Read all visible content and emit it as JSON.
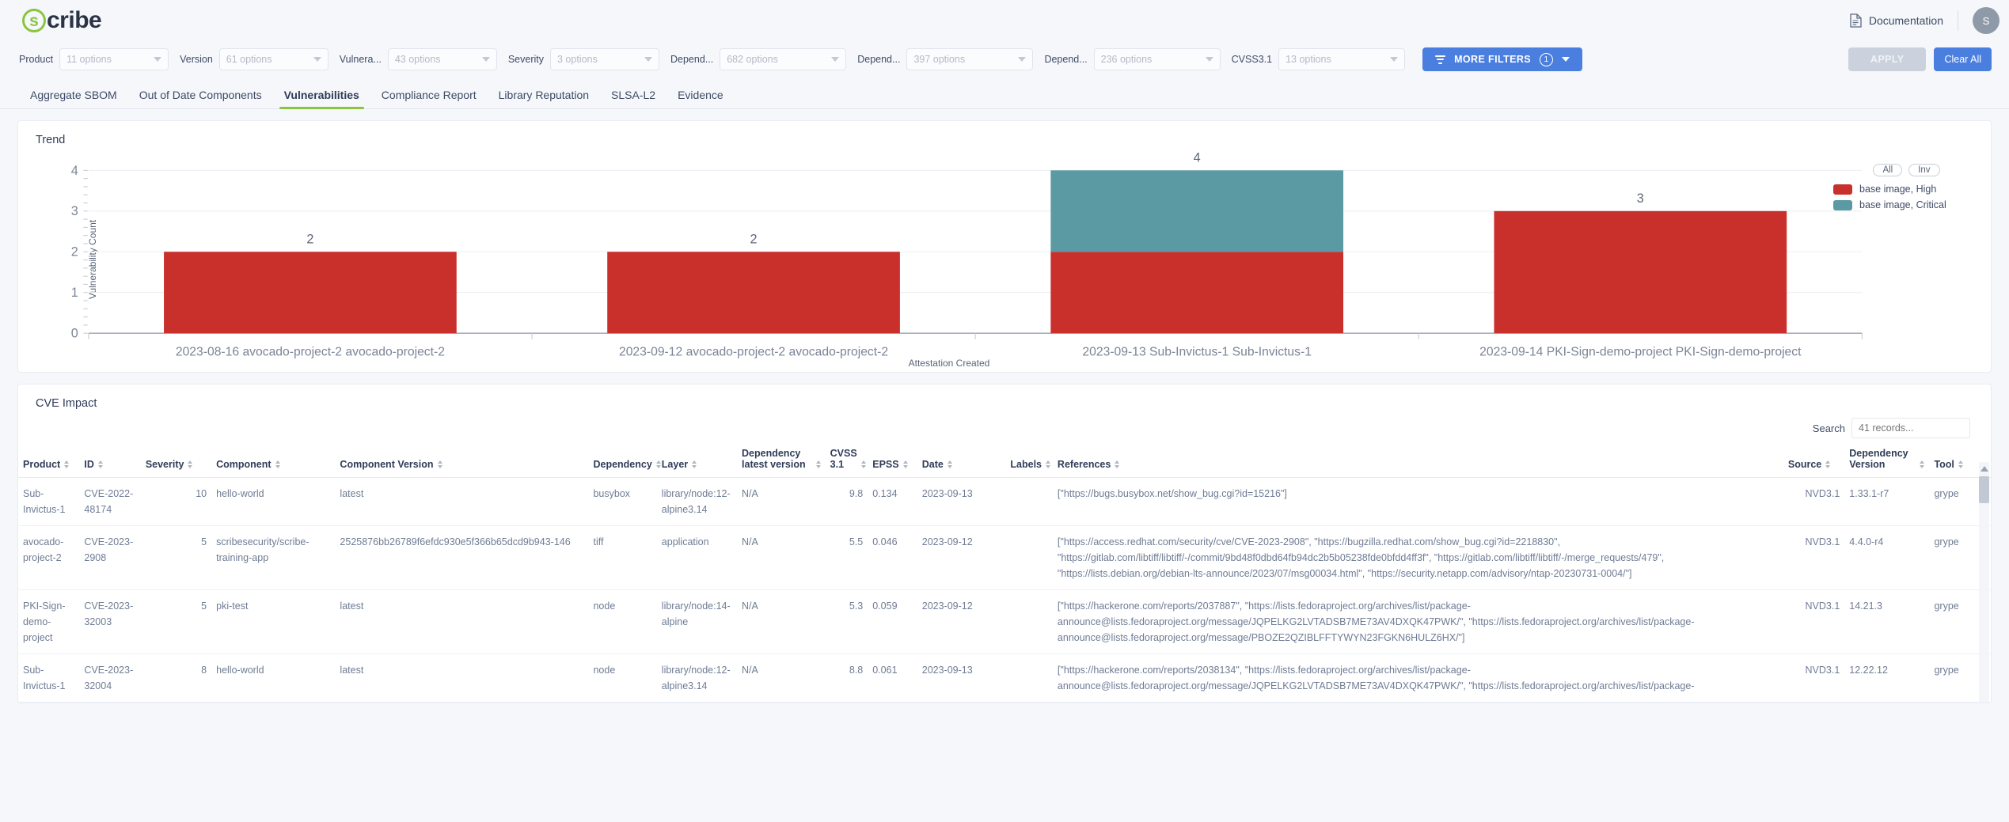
{
  "header": {
    "brand": "scribe",
    "brand_initial": "s",
    "documentation_label": "Documentation",
    "doc_icon": "document-icon",
    "avatar_initial": "S"
  },
  "filters": [
    {
      "label": "Product",
      "value": "11 options",
      "name": "product"
    },
    {
      "label": "Version",
      "value": "61 options",
      "name": "version"
    },
    {
      "label": "Vulnera...",
      "value": "43 options",
      "name": "vulnerability"
    },
    {
      "label": "Severity",
      "value": "3 options",
      "name": "severity"
    },
    {
      "label": "Depend...",
      "value": "682 options",
      "name": "dependency-1"
    },
    {
      "label": "Depend...",
      "value": "397 options",
      "name": "dependency-2"
    },
    {
      "label": "Depend...",
      "value": "236 options",
      "name": "dependency-3"
    },
    {
      "label": "CVSS3.1",
      "value": "13 options",
      "name": "cvss31"
    }
  ],
  "toolbar": {
    "more_filters_label": "MORE FILTERS",
    "more_filters_count": "1",
    "apply_label": "APPLY",
    "clear_all_label": "Clear All"
  },
  "tabs": [
    {
      "label": "Aggregate SBOM",
      "active": false
    },
    {
      "label": "Out of Date Components",
      "active": false
    },
    {
      "label": "Vulnerabilities",
      "active": true
    },
    {
      "label": "Compliance Report",
      "active": false
    },
    {
      "label": "Library Reputation",
      "active": false
    },
    {
      "label": "SLSA-L2",
      "active": false
    },
    {
      "label": "Evidence",
      "active": false
    }
  ],
  "trend": {
    "title": "Trend",
    "toggles": [
      "All",
      "Inv"
    ]
  },
  "chart_data": {
    "type": "bar",
    "title": "Trend",
    "xlabel": "Attestation Created",
    "ylabel": "Vulnerability Count",
    "ylim": [
      0,
      4
    ],
    "yticks": [
      "0",
      "1",
      "2",
      "3",
      "4"
    ],
    "grid": true,
    "legend_position": "right",
    "stacked": true,
    "categories": [
      "2023-08-16 avocado-project-2 avocado-project-2",
      "2023-09-12 avocado-project-2 avocado-project-2",
      "2023-09-13 Sub-Invictus-1 Sub-Invictus-1",
      "2023-09-14 PKI-Sign-demo-project PKI-Sign-demo-project"
    ],
    "totals": [
      "2",
      "2",
      "4",
      "3"
    ],
    "series": [
      {
        "name": "base image, High",
        "color": "#c9302c",
        "values": [
          2,
          2,
          2,
          3
        ]
      },
      {
        "name": "base image, Critical",
        "color": "#5b9aa3",
        "values": [
          0,
          0,
          2,
          0
        ]
      }
    ]
  },
  "cve_impact": {
    "title": "CVE Impact",
    "search_label": "Search",
    "search_placeholder": "41 records...",
    "search_value": "",
    "columns": [
      {
        "label": "Product",
        "sortable": true
      },
      {
        "label": "ID",
        "sortable": true
      },
      {
        "label": "Severity",
        "sortable": true
      },
      {
        "label": "Component",
        "sortable": true
      },
      {
        "label": "Component Version",
        "sortable": true
      },
      {
        "label": "Dependency",
        "sortable": true
      },
      {
        "label": "Layer",
        "sortable": true
      },
      {
        "label": "Dependency latest version",
        "sortable": true
      },
      {
        "label": "CVSS 3.1",
        "sortable": true
      },
      {
        "label": "EPSS",
        "sortable": true
      },
      {
        "label": "Date",
        "sortable": true
      },
      {
        "label": "Labels",
        "sortable": true
      },
      {
        "label": "References",
        "sortable": true
      },
      {
        "label": "Source",
        "sortable": true
      },
      {
        "label": "Dependency Version",
        "sortable": true
      },
      {
        "label": "Tool",
        "sortable": true
      }
    ],
    "rows": [
      {
        "product": "Sub-Invictus-1",
        "id": "CVE-2022-48174",
        "severity": "10",
        "component": "hello-world",
        "component_version": "latest",
        "dependency": "busybox",
        "layer": "library/node:12-alpine3.14",
        "dependency_latest_version": "N/A",
        "cvss31": "9.8",
        "epss": "0.134",
        "date": "2023-09-13",
        "labels": "",
        "references": "[\"https://bugs.busybox.net/show_bug.cgi?id=15216\"]",
        "source": "NVD3.1",
        "dependency_version": "1.33.1-r7",
        "tool": "grype"
      },
      {
        "product": "avocado-project-2",
        "id": "CVE-2023-2908",
        "severity": "5",
        "component": "scribesecurity/scribe-training-app",
        "component_version": "2525876bb26789f6efdc930e5f366b65dcd9b943-146",
        "dependency": "tiff",
        "layer": "application",
        "dependency_latest_version": "N/A",
        "cvss31": "5.5",
        "epss": "0.046",
        "date": "2023-09-12",
        "labels": "",
        "references": "[\"https://access.redhat.com/security/cve/CVE-2023-2908\", \"https://bugzilla.redhat.com/show_bug.cgi?id=2218830\", \"https://gitlab.com/libtiff/libtiff/-/commit/9bd48f0dbd64fb94dc2b5b05238fde0bfdd4ff3f\", \"https://gitlab.com/libtiff/libtiff/-/merge_requests/479\", \"https://lists.debian.org/debian-lts-announce/2023/07/msg00034.html\", \"https://security.netapp.com/advisory/ntap-20230731-0004/\"]",
        "source": "NVD3.1",
        "dependency_version": "4.4.0-r4",
        "tool": "grype"
      },
      {
        "product": "PKI-Sign-demo-project",
        "id": "CVE-2023-32003",
        "severity": "5",
        "component": "pki-test",
        "component_version": "latest",
        "dependency": "node",
        "layer": "library/node:14-alpine",
        "dependency_latest_version": "N/A",
        "cvss31": "5.3",
        "epss": "0.059",
        "date": "2023-09-12",
        "labels": "",
        "references": "[\"https://hackerone.com/reports/2037887\", \"https://lists.fedoraproject.org/archives/list/package-announce@lists.fedoraproject.org/message/JQPELKG2LVTADSB7ME73AV4DXQK47PWK/\", \"https://lists.fedoraproject.org/archives/list/package-announce@lists.fedoraproject.org/message/PBOZE2QZIBLFFTYWYN23FGKN6HULZ6HX/\"]",
        "source": "NVD3.1",
        "dependency_version": "14.21.3",
        "tool": "grype"
      },
      {
        "product": "Sub-Invictus-1",
        "id": "CVE-2023-32004",
        "severity": "8",
        "component": "hello-world",
        "component_version": "latest",
        "dependency": "node",
        "layer": "library/node:12-alpine3.14",
        "dependency_latest_version": "N/A",
        "cvss31": "8.8",
        "epss": "0.061",
        "date": "2023-09-13",
        "labels": "",
        "references": "[\"https://hackerone.com/reports/2038134\", \"https://lists.fedoraproject.org/archives/list/package-announce@lists.fedoraproject.org/message/JQPELKG2LVTADSB7ME73AV4DXQK47PWK/\", \"https://lists.fedoraproject.org/archives/list/package-",
        "source": "NVD3.1",
        "dependency_version": "12.22.12",
        "tool": "grype"
      }
    ]
  }
}
